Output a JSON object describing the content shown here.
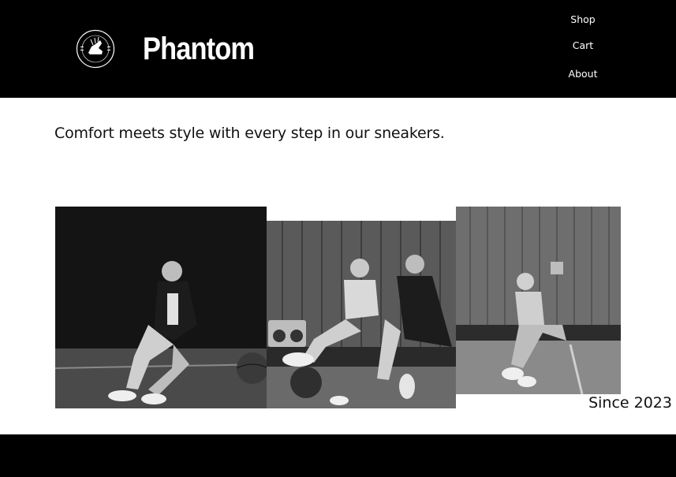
{
  "header": {
    "brand": "Phantom",
    "logo_text_top": "Phantom Sneakers",
    "logo_text_bottom": "COMFORT MEETS STYLE",
    "logo_icon": "winged-sneaker-icon",
    "nav": [
      "Shop",
      "Cart",
      "About"
    ]
  },
  "main": {
    "tagline": "Comfort meets style with every step in our sneakers.",
    "since": "Since 2023",
    "photos": [
      {
        "name": "photo-woman-with-basketball"
      },
      {
        "name": "photo-two-women-with-boombox"
      },
      {
        "name": "photo-woman-sitting-on-court"
      }
    ]
  },
  "colors": {
    "header_bg": "#000000",
    "footer_bg": "#000000",
    "page_bg": "#ffffff",
    "text": "#111111"
  }
}
